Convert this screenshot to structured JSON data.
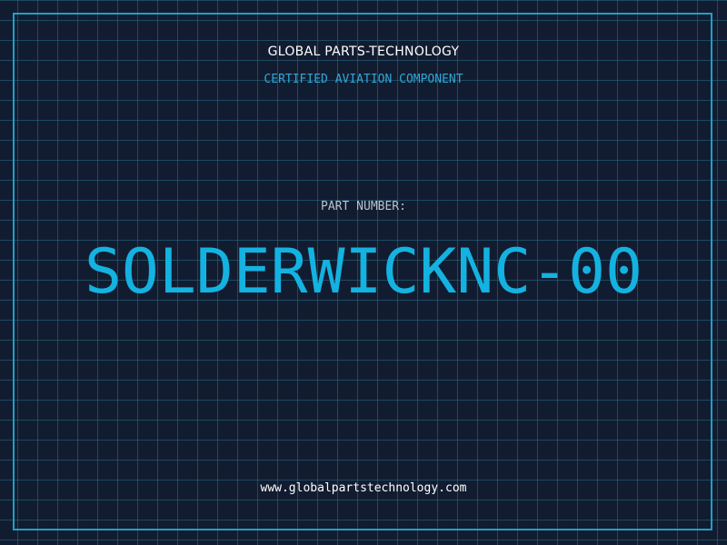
{
  "header": {
    "company": "GLOBAL PARTS-TECHNOLOGY",
    "subtitle": "CERTIFIED AVIATION COMPONENT"
  },
  "part": {
    "label": "PART NUMBER:",
    "number": "SOLDERWICKNC-00"
  },
  "footer": {
    "website": "www.globalpartstechnology.com"
  },
  "colors": {
    "background": "#121c30",
    "grid": "#256e8a",
    "accent": "#14b2e0",
    "frame": "#1f9fc4"
  }
}
